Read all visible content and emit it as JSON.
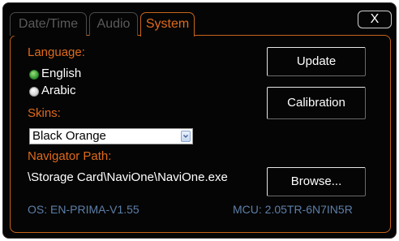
{
  "tabs": [
    {
      "label": "Date/Time",
      "active": false
    },
    {
      "label": "Audio",
      "active": false
    },
    {
      "label": "System",
      "active": true
    }
  ],
  "close_label": "X",
  "language": {
    "label": "Language:",
    "options": [
      {
        "label": "English",
        "selected": true
      },
      {
        "label": "Arabic",
        "selected": false
      }
    ]
  },
  "skins": {
    "label": "Skins:",
    "selected": "Black Orange"
  },
  "navigator": {
    "label": "Navigator Path:",
    "path": "\\Storage Card\\NaviOne\\NaviOne.exe"
  },
  "buttons": {
    "update": "Update",
    "calibration": "Calibration",
    "browse": "Browse..."
  },
  "footer": {
    "os": "OS: EN-PRIMA-V1.55",
    "mcu": "MCU: 2.05TR-6N7IN5R"
  },
  "colors": {
    "accent": "#e06a1a",
    "background": "#050505",
    "info_text": "#5d7fa8",
    "radio_selected": "#3fa33a"
  }
}
